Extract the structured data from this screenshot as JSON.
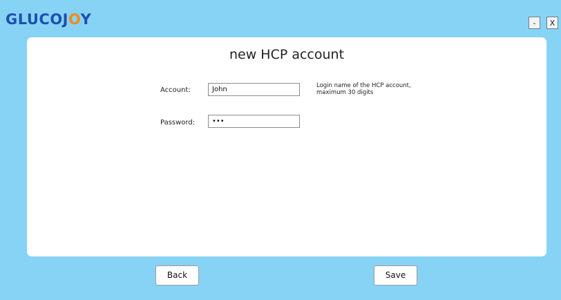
{
  "app": {
    "logo_prefix": "GLUCOJ",
    "logo_accent": "O",
    "logo_suffix": "Y",
    "brand_color": "#1e4fae",
    "accent_color": "#f08a1c"
  },
  "window_controls": {
    "minimize_label": "-",
    "close_label": "X"
  },
  "form": {
    "title": "new HCP account",
    "account_label": "Account:",
    "account_value": "John",
    "account_hint_line1": "Login name of the HCP account,",
    "account_hint_line2": "maximum 30 digits",
    "password_label": "Password:",
    "password_value": "•••"
  },
  "actions": {
    "back_label": "Back",
    "save_label": "Save"
  }
}
